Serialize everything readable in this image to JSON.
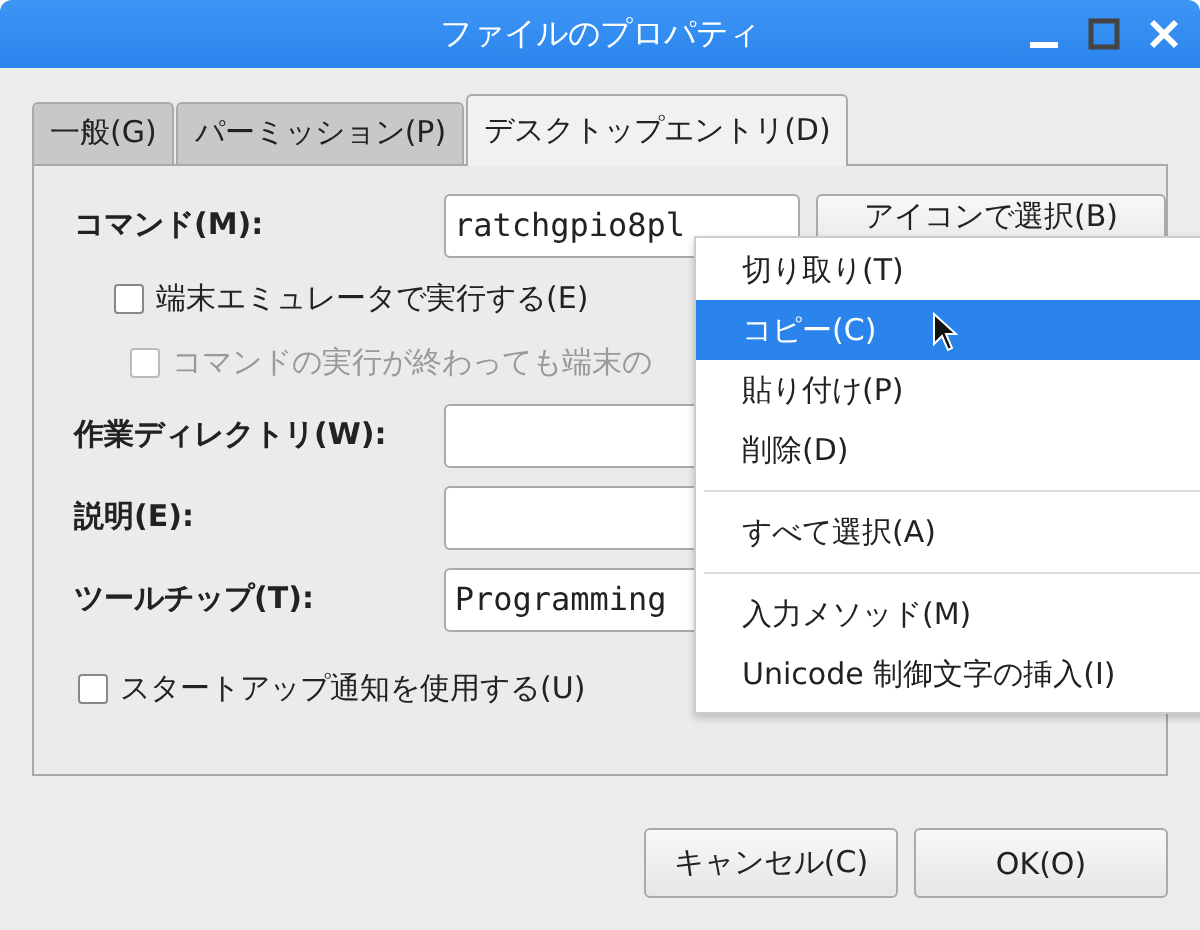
{
  "window": {
    "title": "ファイルのプロパティ"
  },
  "tabs": [
    {
      "label": "一般(G)",
      "selected": false
    },
    {
      "label": "パーミッション(P)",
      "selected": false
    },
    {
      "label": "デスクトップエントリ(D)",
      "selected": true
    }
  ],
  "command": {
    "label": "コマンド(M):",
    "value": "ratchgpio8pl",
    "button": "アイコンで選択(B)"
  },
  "options": [
    {
      "label": "端末エミュレータで実行する(E)",
      "checked": false,
      "disabled": false
    },
    {
      "label": "コマンドの実行が終わっても端末の",
      "checked": false,
      "disabled": true
    }
  ],
  "fields": [
    {
      "label": "作業ディレクトリ(W):"
    },
    {
      "label": "説明(E):"
    },
    {
      "label": "ツールチップ(T):",
      "value": "Programming"
    }
  ],
  "startup": {
    "label": "スタートアップ通知を使用する(U)",
    "checked": false
  },
  "buttons": [
    "キャンセル(C)",
    "OK(O)"
  ],
  "context_menu": [
    {
      "kind": "item",
      "label": "切り取り(T)",
      "selected": false
    },
    {
      "kind": "item",
      "label": "コピー(C)",
      "selected": true
    },
    {
      "kind": "item",
      "label": "貼り付け(P)",
      "selected": false
    },
    {
      "kind": "item",
      "label": "削除(D)",
      "selected": false
    },
    {
      "kind": "separator"
    },
    {
      "kind": "item",
      "label": "すべて選択(A)",
      "selected": false
    },
    {
      "kind": "separator"
    },
    {
      "kind": "item",
      "label": "入力メソッド(M)",
      "selected": false
    },
    {
      "kind": "item",
      "label": "Unicode 制御文字の挿入(I)",
      "selected": false
    }
  ]
}
